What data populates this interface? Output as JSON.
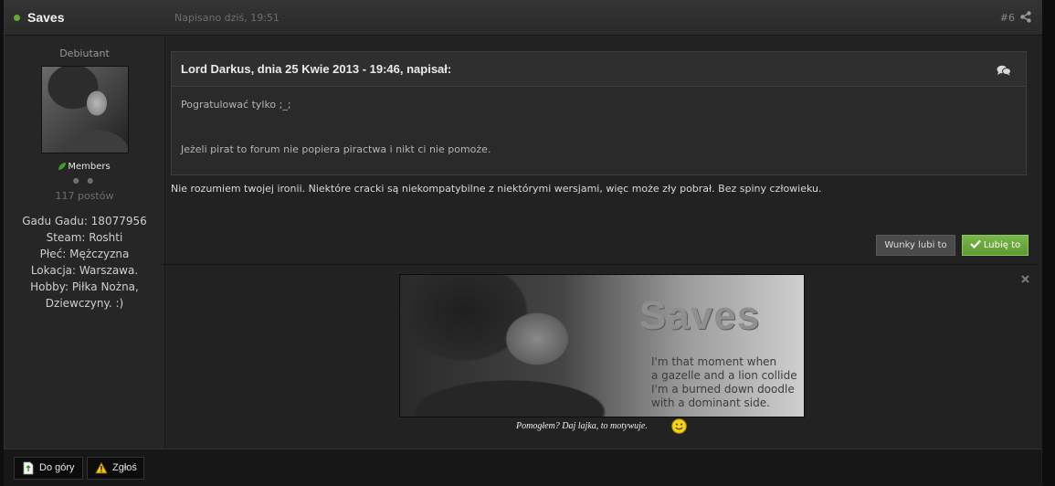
{
  "post": {
    "author": "Saves",
    "date": "Napisano dziś, 19:51",
    "number": "#6",
    "icons": {
      "online": "online-dot",
      "share": "share-icon"
    }
  },
  "sidebar": {
    "rank": "Debiutant",
    "avatar": "avatar",
    "group": "Members",
    "reputation_icon": "rep-dots",
    "post_count": "117 postów",
    "fields": [
      "Gadu Gadu: 18077956",
      "Steam: Roshti",
      "Płeć: Mężczyzna",
      "Lokacja: Warszawa.",
      "Hobby: Piłka Nożna,",
      "Dziewczyny. :)"
    ]
  },
  "quote": {
    "citation": "Lord Darkus, dnia 25 Kwie 2013 - 19:46, napisał:",
    "icon": "speech-bubbles-icon",
    "line1": "Pogratulować tylko ;_;",
    "line2": "Jeżeli pirat to forum nie popiera piractwa i nikt ci nie pomoże."
  },
  "post_text": "Nie rozumiem twojej ironii. Niektóre cracki są niekompatybilne z niektórymi wersjami, więc może zły pobrał. Bez spiny człowieku.",
  "likes": {
    "users_label": "Wunky lubi to",
    "like_label": "Lubię to"
  },
  "signature": {
    "banner_title": "Saves",
    "banner_poem": [
      "I'm that moment when",
      "a gazelle and a lion collide",
      "I'm a burned down doodle",
      "with a dominant side."
    ],
    "caption": "Pomogłem? Daj lajka, to motywuje."
  },
  "bottom": {
    "top_label": "Do góry",
    "report_label": "Zgłoś"
  },
  "colors": {
    "background": "#222222",
    "header": "#2f2f2f",
    "like_green": "#6aa83c",
    "online_green": "#5fae2e"
  }
}
